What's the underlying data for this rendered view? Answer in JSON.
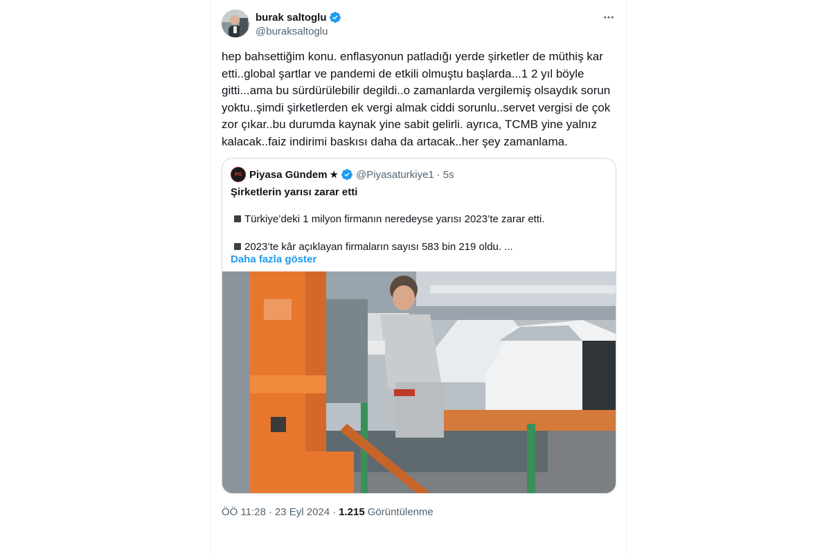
{
  "author": {
    "display_name": "burak saltoglu",
    "handle": "@buraksaltoglu",
    "verified_color": "#1d9bf0"
  },
  "menu_icon": "more-horizontal-icon",
  "tweet_text": "hep bahsettiğim konu. enflasyonun patladığı yerde şirketler de müthiş kar etti..global şartlar ve pandemi de etkili olmuştu başlarda...1 2 yıl böyle gitti...ama bu sürdürülebilir degildi..o zamanlarda vergilemiş olsaydık sorun yoktu..şimdi şirketlerden ek vergi almak ciddi sorunlu..servet vergisi de çok zor çıkar..bu durumda kaynak yine sabit gelirli. ayrıca, TCMB yine yalnız kalacak..faiz indirimi baskısı daha da artacak..her şey zamanlama.",
  "quote": {
    "avatar_text": "PG",
    "display_name": "Piyasa Gündem",
    "star": "★",
    "handle": "@Piyasaturkiye1",
    "separator": "·",
    "time": "5s",
    "title": "Şirketlerin yarısı zarar etti",
    "bullets": [
      "Türkiye’deki 1 milyon firmanın neredeyse yarısı 2023’te zarar etti.",
      "2023’te kâr açıklayan firmaların sayısı 583 bin 219 oldu. ..."
    ],
    "show_more": "Daha fazla göster",
    "image_alt": "factory-photo"
  },
  "meta": {
    "time": "ÖÖ 11:28",
    "separator": "·",
    "date": "23 Eyl 2024",
    "views_count": "1.215",
    "views_label": "Görüntülenme"
  }
}
